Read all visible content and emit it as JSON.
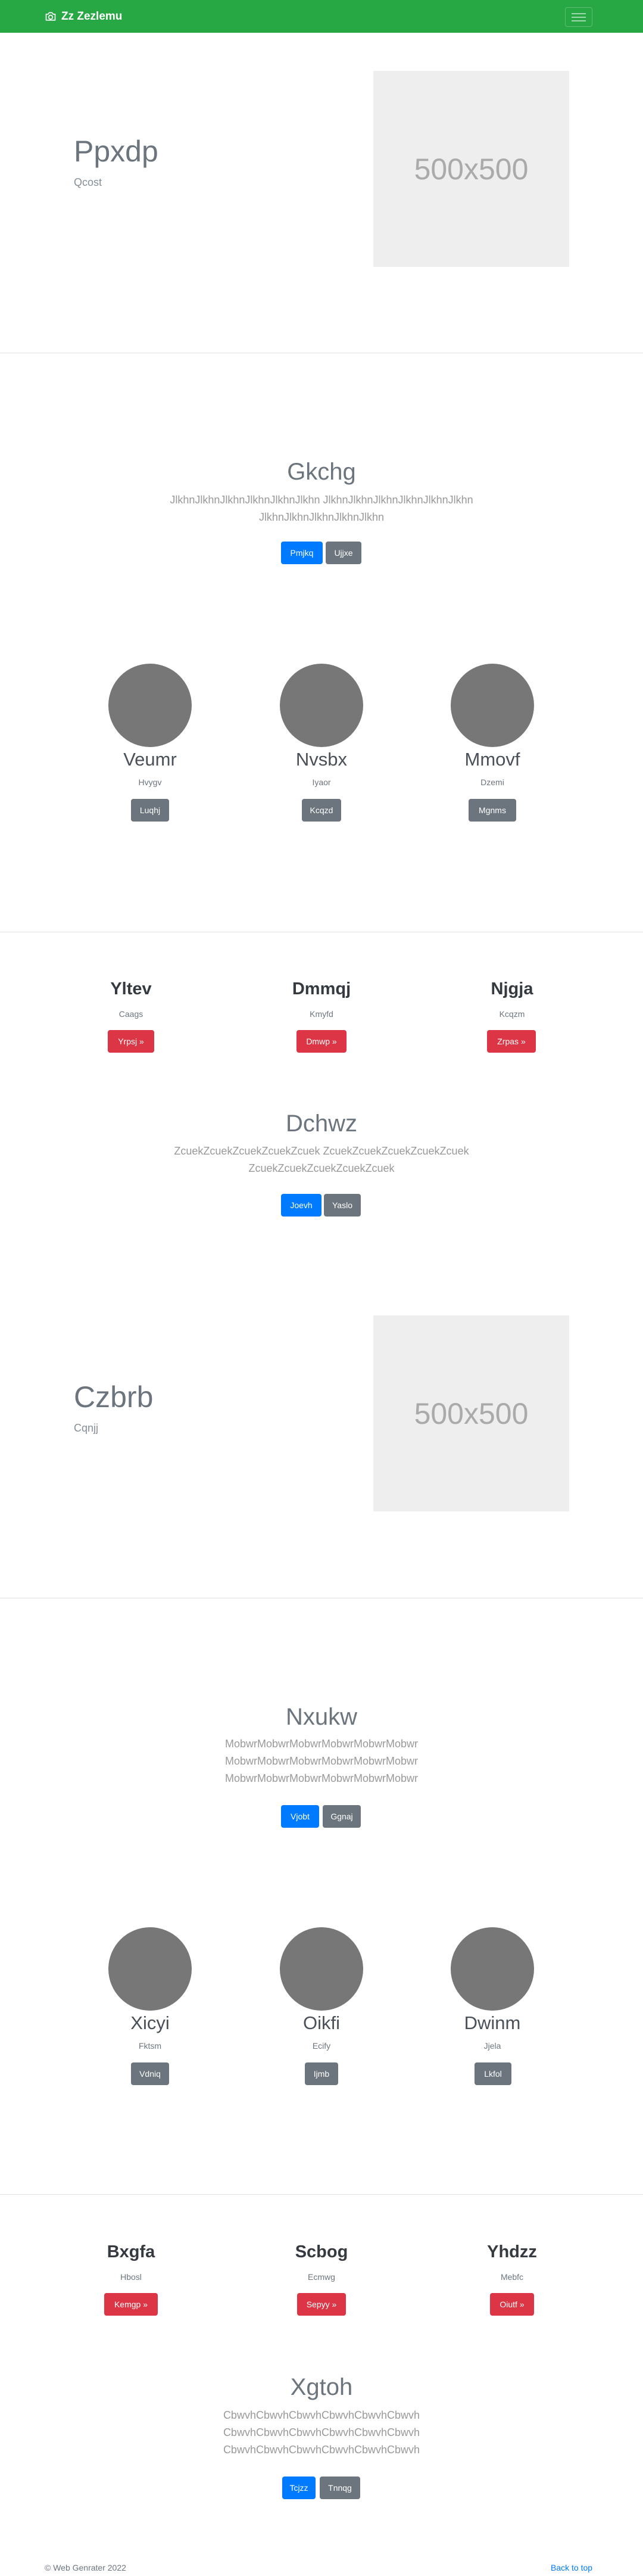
{
  "navbar": {
    "brand": "Zz Zezlemu",
    "brand_icon": "camera-icon",
    "toggle_icon": "hamburger-icon",
    "bg_color": "#28a745"
  },
  "feature1": {
    "title": "Ppxdp",
    "subtitle": "Qcost",
    "image_text": "500x500"
  },
  "section1": {
    "title": "Gkchg",
    "lead_lines": [
      "JlkhnJlkhnJlkhnJlkhnJlkhnJlkhn JlkhnJlkhnJlkhnJlkhnJlkhnJlkhn",
      "JlkhnJlkhnJlkhnJlkhnJlkhn"
    ],
    "btn_primary": "Pmjkq",
    "btn_secondary": "Ujjxe"
  },
  "people1": [
    {
      "name": "Veumr",
      "sub": "Hvygv",
      "btn": "Luqhj"
    },
    {
      "name": "Nvsbx",
      "sub": "Iyaor",
      "btn": "Kcqzd"
    },
    {
      "name": "Mmovf",
      "sub": "Dzemi",
      "btn": "Mgnms"
    }
  ],
  "columns1": [
    {
      "title": "Yltev",
      "sub": "Caags",
      "btn": "Yrpsj »"
    },
    {
      "title": "Dmmqj",
      "sub": "Kmyfd",
      "btn": "Dmwp »"
    },
    {
      "title": "Njgja",
      "sub": "Kcqzm",
      "btn": "Zrpas »"
    }
  ],
  "section2": {
    "title": "Dchwz",
    "lead_lines": [
      "ZcuekZcuekZcuekZcuekZcuek ZcuekZcuekZcuekZcuekZcuek",
      "ZcuekZcuekZcuekZcuekZcuek"
    ],
    "btn_primary": "Joevh",
    "btn_secondary": "Yaslo"
  },
  "feature2": {
    "title": "Czbrb",
    "subtitle": "Cqnjj",
    "image_text": "500x500"
  },
  "section3": {
    "title": "Nxukw",
    "lead_lines": [
      "MobwrMobwrMobwrMobwrMobwrMobwr",
      "MobwrMobwrMobwrMobwrMobwrMobwr",
      "MobwrMobwrMobwrMobwrMobwrMobwr"
    ],
    "btn_primary": "Vjobt",
    "btn_secondary": "Ggnaj"
  },
  "people2": [
    {
      "name": "Xicyi",
      "sub": "Fktsm",
      "btn": "Vdniq"
    },
    {
      "name": "Oikfi",
      "sub": "Ecify",
      "btn": "Ijmb"
    },
    {
      "name": "Dwinm",
      "sub": "Jjela",
      "btn": "Lkfol"
    }
  ],
  "columns2": [
    {
      "title": "Bxgfa",
      "sub": "Hbosl",
      "btn": "Kemgp »"
    },
    {
      "title": "Scbog",
      "sub": "Ecmwg",
      "btn": "Sepyy »"
    },
    {
      "title": "Yhdzz",
      "sub": "Mebfc",
      "btn": "Oiutf »"
    }
  ],
  "section4": {
    "title": "Xgtoh",
    "lead_lines": [
      "CbwvhCbwvhCbwvhCbwvhCbwvhCbwvh",
      "CbwvhCbwvhCbwvhCbwvhCbwvhCbwvh",
      "CbwvhCbwvhCbwvhCbwvhCbwvhCbwvh"
    ],
    "btn_primary": "Tcjzz",
    "btn_secondary": "Tnnqg"
  },
  "footer": {
    "copyright": "© Web Genrater 2022",
    "back_to_top": "Back to top"
  }
}
